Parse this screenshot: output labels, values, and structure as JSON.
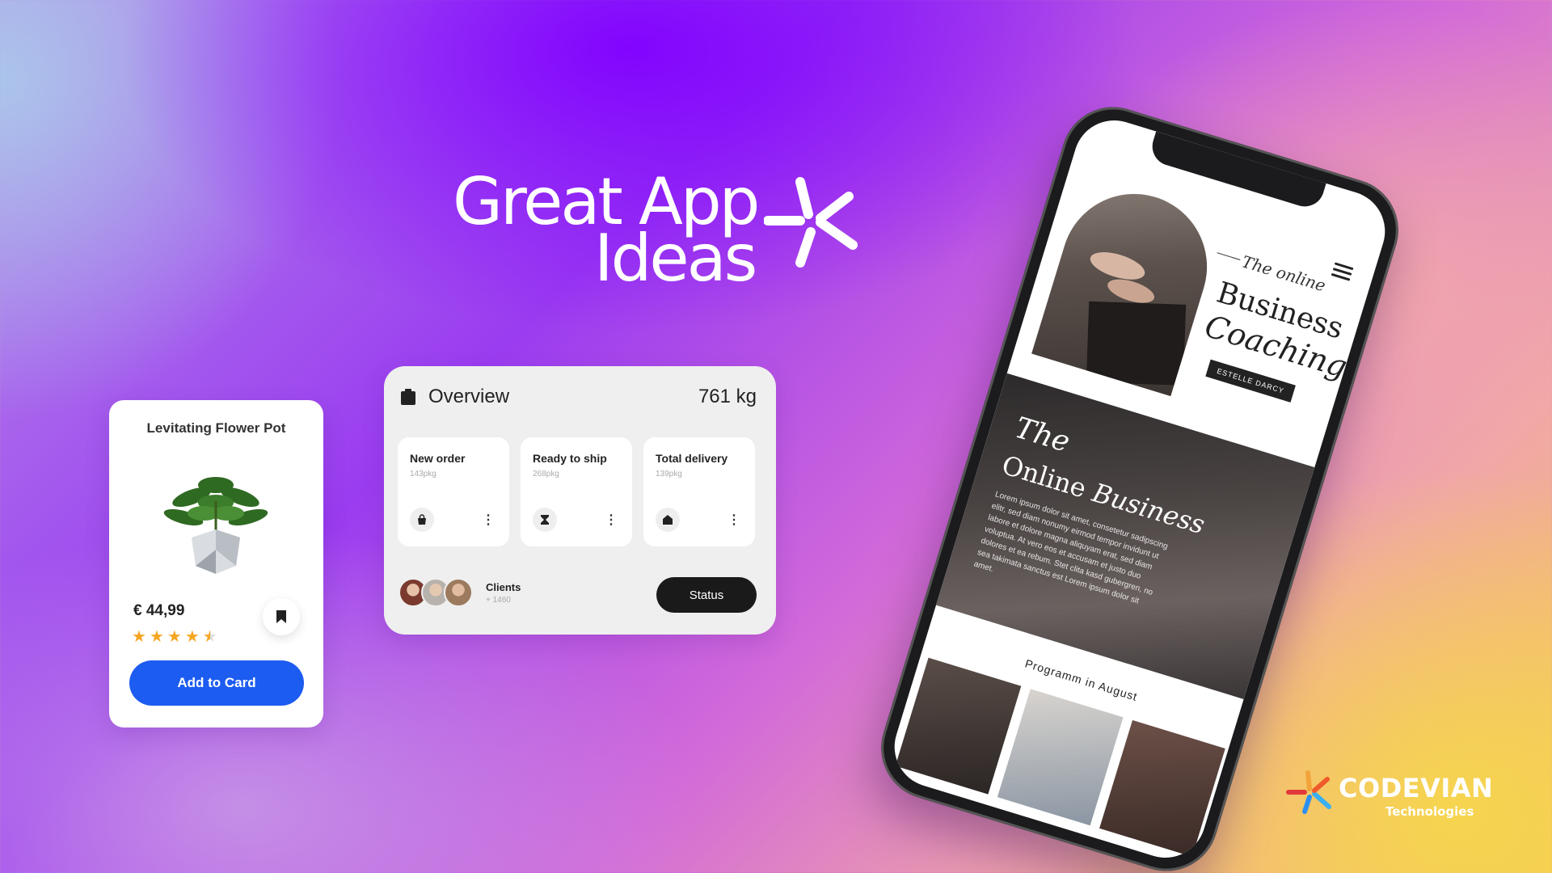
{
  "headline": {
    "line1": "Great App",
    "line2": "Ideas"
  },
  "product": {
    "title": "Levitating Flower Pot",
    "price": "€ 44,99",
    "rating": 4.5,
    "button_label": "Add to Card"
  },
  "overview": {
    "title": "Overview",
    "weight": "761 kg",
    "tiles": [
      {
        "name": "New order",
        "sub": "143pkg",
        "icon": "bag-icon"
      },
      {
        "name": "Ready to ship",
        "sub": "268pkg",
        "icon": "hourglass-icon"
      },
      {
        "name": "Total delivery",
        "sub": "139pkg",
        "icon": "home-icon"
      }
    ],
    "clients_label": "Clients",
    "clients_count": "+ 1460",
    "status_label": "Status"
  },
  "phone": {
    "script_small": "The online",
    "title_line1": "Business",
    "title_line2": "Coaching",
    "badge": "ESTELLE DARCY",
    "mid_the": "The",
    "mid_title_plain": "Online ",
    "mid_title_italic": "Business",
    "mid_body": "Lorem ipsum dolor sit amet, consetetur sadipscing elitr, sed diam nonumy eirmod tempor invidunt ut labore et dolore magna aliquyam erat, sed diam voluptua. At vero eos et accusam et justo duo dolores et ea rebum. Stet clita kasd gubergren, no sea takimata sanctus est Lorem ipsum dolor sit amet.",
    "programm_title": "Programm in August"
  },
  "brand": {
    "name": "CODEVIAN",
    "sub": "Technologies"
  },
  "colors": {
    "accent_blue": "#1d5cf0",
    "star": "#f5a623",
    "dark": "#1a1a1a"
  }
}
